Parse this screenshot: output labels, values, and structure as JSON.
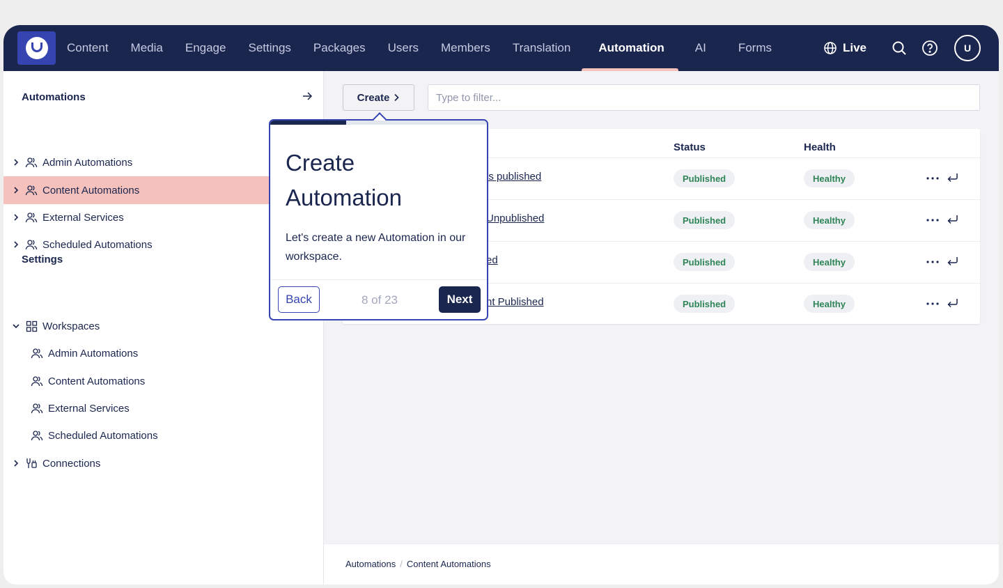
{
  "nav": {
    "items": [
      "Content",
      "Media",
      "Engage",
      "Settings",
      "Packages",
      "Users",
      "Members",
      "Translation",
      "Automation",
      "AI",
      "Forms"
    ],
    "active": "Automation",
    "live_label": "Live",
    "avatar_initials": "U"
  },
  "sidebar": {
    "automations_title": "Automations",
    "automation_items": [
      "Admin Automations",
      "Content Automations",
      "External Services",
      "Scheduled Automations"
    ],
    "selected": "Content Automations",
    "settings_title": "Settings",
    "workspaces_label": "Workspaces",
    "workspace_items": [
      "Admin Automations",
      "Content Automations",
      "External Services",
      "Scheduled Automations"
    ],
    "connections_label": "Connections"
  },
  "toolbar": {
    "create_label": "Create",
    "filter_placeholder": "Type to filter..."
  },
  "table": {
    "columns": {
      "status": "Status",
      "health": "Health"
    },
    "rows": [
      {
        "name": "is published",
        "status": "Published",
        "health": "Healthy"
      },
      {
        "name": "Unpublished",
        "status": "Published",
        "health": "Healthy"
      },
      {
        "name": "ed",
        "status": "Published",
        "health": "Healthy"
      },
      {
        "name": "nt Published",
        "status": "Published",
        "health": "Healthy"
      }
    ]
  },
  "breadcrumb": [
    "Automations",
    "Content Automations"
  ],
  "tour": {
    "title": "Create Automation",
    "body": "Let's create a new Automation in our workspace.",
    "back_label": "Back",
    "next_label": "Next",
    "step_text": "8 of 23",
    "progress_fraction": 0.35
  },
  "colors": {
    "header_bg": "#1b264f",
    "accent": "#3544b1",
    "selected_bg": "#f5c1bc",
    "status_text": "#2e8457"
  }
}
